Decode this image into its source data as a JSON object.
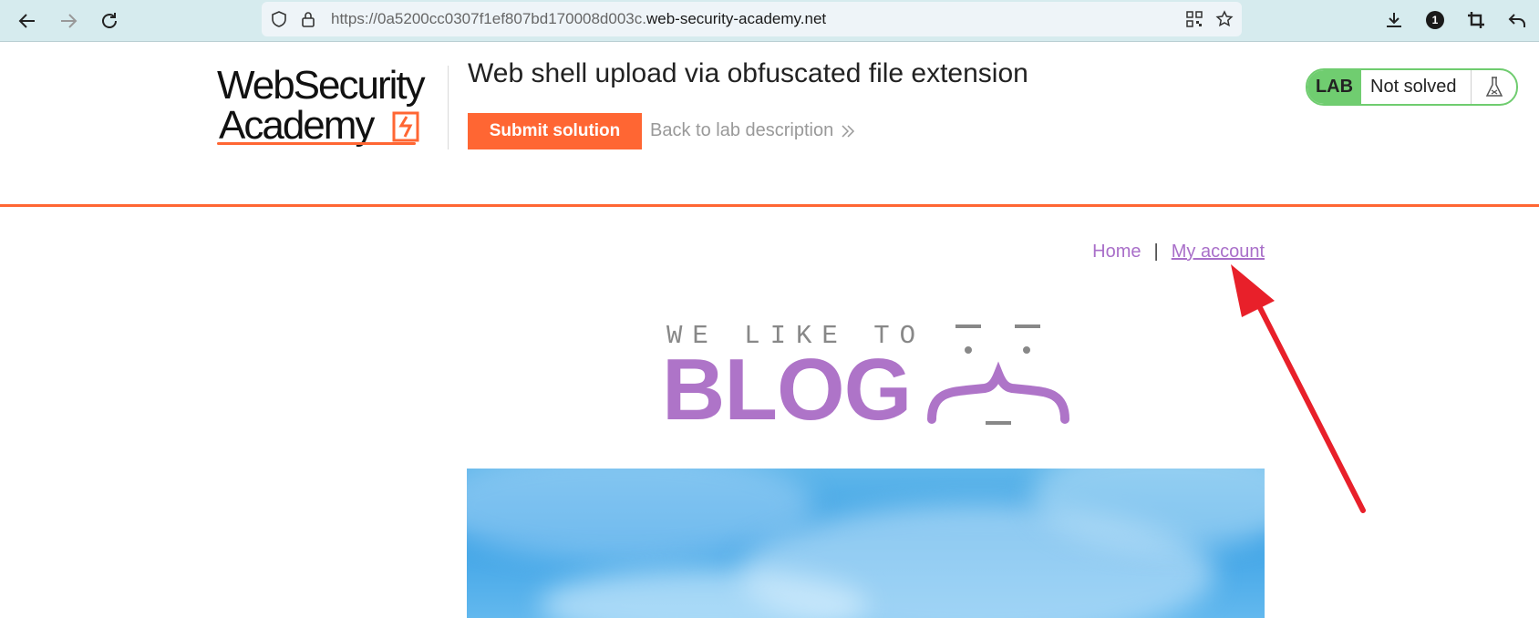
{
  "browser": {
    "url_prefix": "https://0a5200cc0307f1ef807bd170008d003c.",
    "url_host": "web-security-academy.net",
    "extension_badge": "1"
  },
  "lab": {
    "logo_line1": "WebSecurity",
    "logo_line2": "Academy",
    "title": "Web shell upload via obfuscated file extension",
    "submit_label": "Submit solution",
    "back_label": "Back to lab description",
    "status_tag": "LAB",
    "status_text": "Not solved",
    "accent_color": "#ff6633",
    "status_color": "#70cd70"
  },
  "blog": {
    "nav_home": "Home",
    "nav_separator": "|",
    "nav_account": "My account",
    "tagline": "WE LIKE TO",
    "brand": "BLOG",
    "link_color": "#a96fc9"
  },
  "annotation": {
    "arrow_color": "#e8202a",
    "points_to": "My account"
  }
}
